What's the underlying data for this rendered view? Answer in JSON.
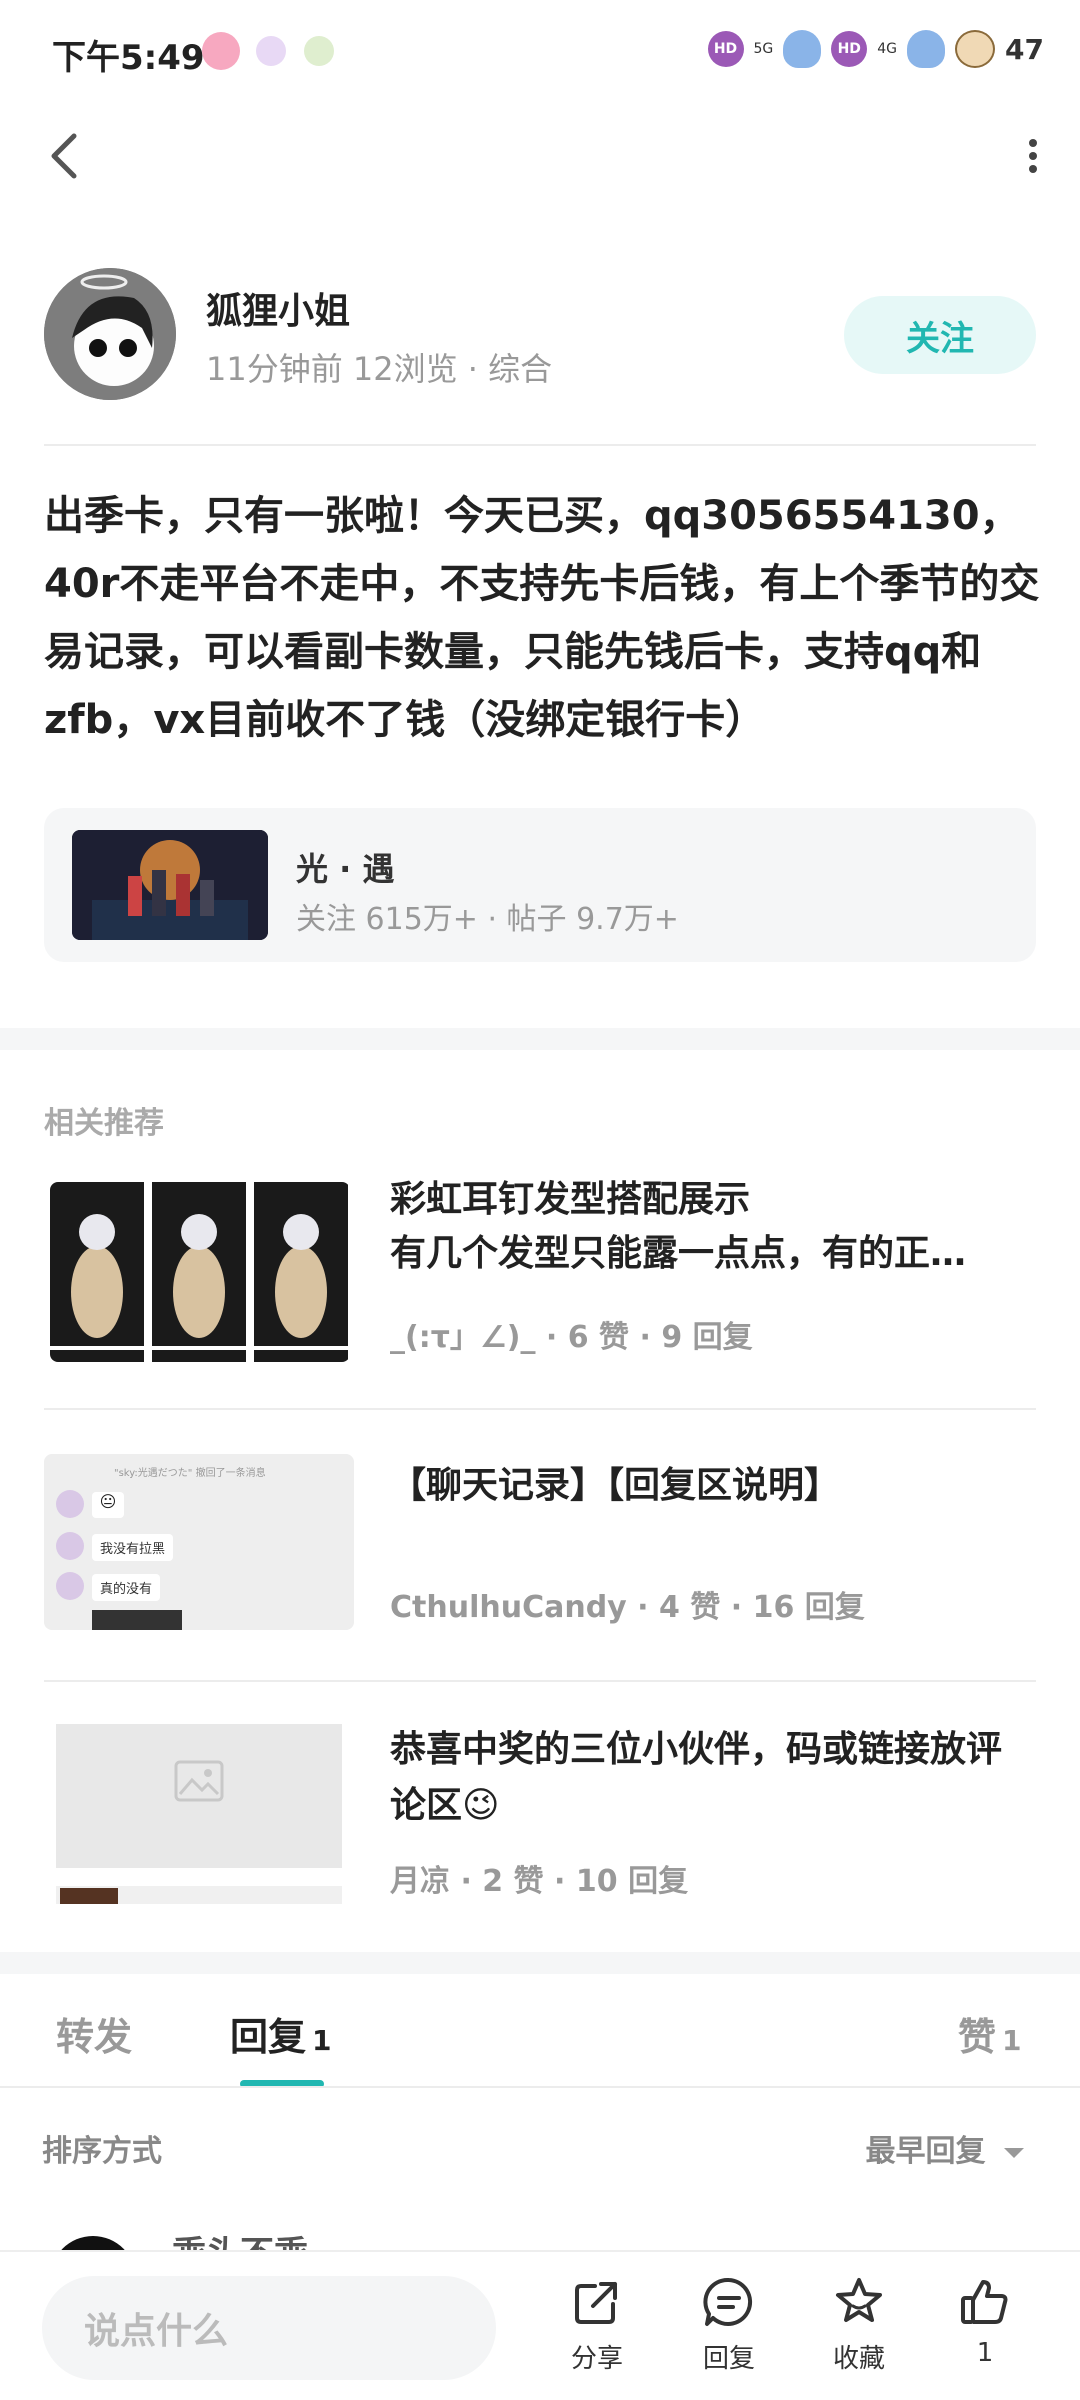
{
  "status_bar": {
    "time": "下午5:49",
    "net1": "5G",
    "net2": "4G",
    "hd_label": "HD",
    "battery": "47"
  },
  "author": {
    "name": "狐狸小姐",
    "meta": "11分钟前  12浏览  ·  综合",
    "follow_label": "关注"
  },
  "post": {
    "body": "出季卡，只有一张啦！今天已买，qq3056554130，40r不走平台不走中，不支持先卡后钱，有上个季节的交易记录，可以看副卡数量，只能先钱后卡，支持qq和zfb，vx目前收不了钱（没绑定银行卡）"
  },
  "circle": {
    "name": "光 · 遇",
    "stats": "关注 615万+  ·  帖子 9.7万+"
  },
  "recommend": {
    "title": "相关推荐",
    "items": [
      {
        "title": "彩虹耳钉发型搭配展示",
        "subtitle": "有几个发型只能露一点点，有的正…",
        "meta": "_(:τ」∠)_  ·  6 赞  ·  9 回复"
      },
      {
        "title": "【聊天记录】【回复区说明】",
        "subtitle": "",
        "meta": "CthulhuCandy  ·  4 赞  ·  16 回复",
        "thumb_texts": [
          "\"sky:光遇だつた\" 撤回了一条消息",
          "我没有拉黑",
          "真的没有"
        ]
      },
      {
        "title": "恭喜中奖的三位小伙伴，码或链接放评论区😉",
        "subtitle": "",
        "meta": "月凉  ·  2 赞  ·  10 回复"
      }
    ]
  },
  "tabs": {
    "forward": "转发",
    "reply": "回复",
    "reply_count": "1",
    "like": "赞",
    "like_count": "1"
  },
  "sort": {
    "label": "排序方式",
    "value": "最早回复"
  },
  "comment_peek": {
    "name": "乖头不乖"
  },
  "bottom_bar": {
    "input_placeholder": "说点什么",
    "share": "分享",
    "reply": "回复",
    "favorite": "收藏",
    "like_count": "1"
  },
  "colors": {
    "accent": "#21b7b1",
    "follow_bg": "#e6f8f7",
    "muted": "#999999"
  }
}
